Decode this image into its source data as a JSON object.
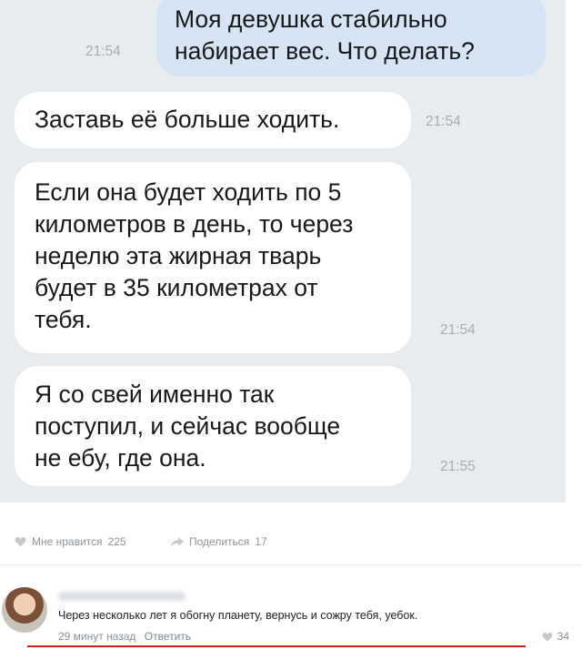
{
  "messages": [
    {
      "side": "out",
      "lines": [
        "Моя девушка стабильно",
        "набирает вес. Что делать?"
      ],
      "time": "21:54"
    },
    {
      "side": "in",
      "lines": [
        "Заставь её больше ходить."
      ],
      "time": "21:54"
    },
    {
      "side": "in",
      "lines": [
        "Если она будет ходить по 5",
        "километров в день, то через",
        "неделю эта жирная тварь",
        "будет в 35 километрах от",
        "тебя."
      ],
      "time": "21:54"
    },
    {
      "side": "in",
      "lines": [
        "Я со свей именно так",
        "поступил, и сейчас вообще",
        "не ебу, где она."
      ],
      "time": "21:55"
    }
  ],
  "post_actions": {
    "like_label": "Мне нравится",
    "like_count": "225",
    "share_label": "Поделиться",
    "share_count": "17"
  },
  "comment": {
    "text": "Через несколько лет я обогну планету, вернусь и сожру тебя, уебок.",
    "time": "29 минут назад",
    "reply_label": "Ответить",
    "likes": "34"
  },
  "colors": {
    "chat_bg": "#e9ecef",
    "outgoing_bubble": "#d6e4f3",
    "incoming_bubble": "#ffffff",
    "underline_red": "#c81e24"
  },
  "icons": [
    "heart-icon",
    "share-icon",
    "avatar"
  ]
}
